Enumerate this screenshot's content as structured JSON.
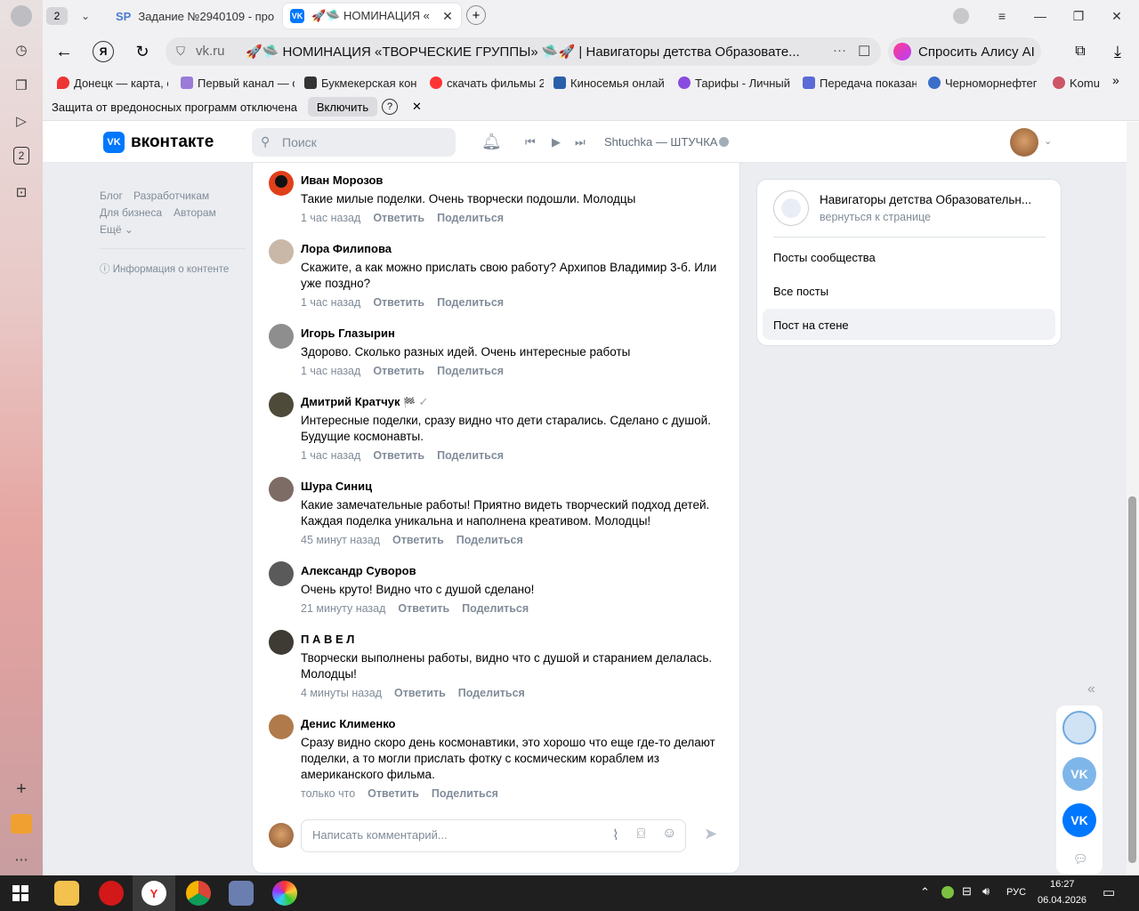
{
  "browser": {
    "tab_count": "2",
    "tabs": [
      {
        "label": "Задание №2940109 - про"
      },
      {
        "label": "🚀🛸 НОМИНАЦИЯ «"
      }
    ],
    "url_host": "vk.ru",
    "page_title": "🚀🛸 НОМИНАЦИЯ «ТВОРЧЕСКИЕ ГРУППЫ» 🛸🚀 | Навигаторы детства Образовате...",
    "alice_label": "Спросить Алису AI",
    "bookmarks": [
      "Донецк — карта, с",
      "Первый канал — с",
      "Букмекерская кон",
      "скачать фильмы 2",
      "Киносемья онлай",
      "Тарифы - Личный",
      "Передача показан",
      "Черноморнефтег",
      "Komu"
    ],
    "protection_text": "Защита от вредоносных программ отключена",
    "protection_button": "Включить",
    "sidebar_badge": "2"
  },
  "vk": {
    "logo": "вконтакте",
    "search_placeholder": "Поиск",
    "player_track": "Shtuchka — ШТУЧКА",
    "left_links": {
      "blog": "Блог",
      "dev": "Разработчикам",
      "biz": "Для бизнеса",
      "authors": "Авторам",
      "more": "Ещё",
      "info": "Информация о контенте"
    },
    "comments": [
      {
        "name": "Иван Морозов",
        "text": "Такие милые поделки. Очень творчески подошли. Молодцы",
        "time": "1 час назад"
      },
      {
        "name": "Лора Филипова",
        "text": "Скажите, а как можно прислать свою работу? Архипов Владимир 3-б. Или уже поздно?",
        "time": "1 час назад"
      },
      {
        "name": "Игорь Глазырин",
        "text": "Здорово. Сколько разных идей. Очень интересные работы",
        "time": "1 час назад"
      },
      {
        "name": "Дмитрий Кратчук",
        "text": "Интересные поделки, сразу видно что дети старались. Сделано с душой. Будущие космонавты.",
        "time": "1 час назад"
      },
      {
        "name": "Шура Синиц",
        "text": "Какие замечательные работы! Приятно видеть творческий подход детей. Каждая поделка уникальна и наполнена креативом. Молодцы!",
        "time": "45 минут назад"
      },
      {
        "name": "Александр Суворов",
        "text": "Очень круто! Видно что с душой сделано!",
        "time": "21 минуту назад"
      },
      {
        "name": "П А В Е Л",
        "text": "Творчески выполнены работы, видно что с душой и старанием делалась. Молодцы!",
        "time": "4 минуты назад"
      },
      {
        "name": "Денис Клименко",
        "text": "Сразу видно скоро день космонавтики, это хорошо что еще где-то делают поделки, а то могли прислать фотку с космическим кораблем из американского фильма.",
        "time": "только что"
      }
    ],
    "reply_label": "Ответить",
    "share_label": "Поделиться",
    "comment_placeholder": "Написать комментарий...",
    "group_name": "Навигаторы детства Образовательн...",
    "back_link": "вернуться к странице",
    "menu": [
      "Посты сообщества",
      "Все посты",
      "Пост на стене"
    ]
  },
  "taskbar": {
    "lang": "РУС",
    "time": "16:27",
    "date": "06.04.2026"
  }
}
